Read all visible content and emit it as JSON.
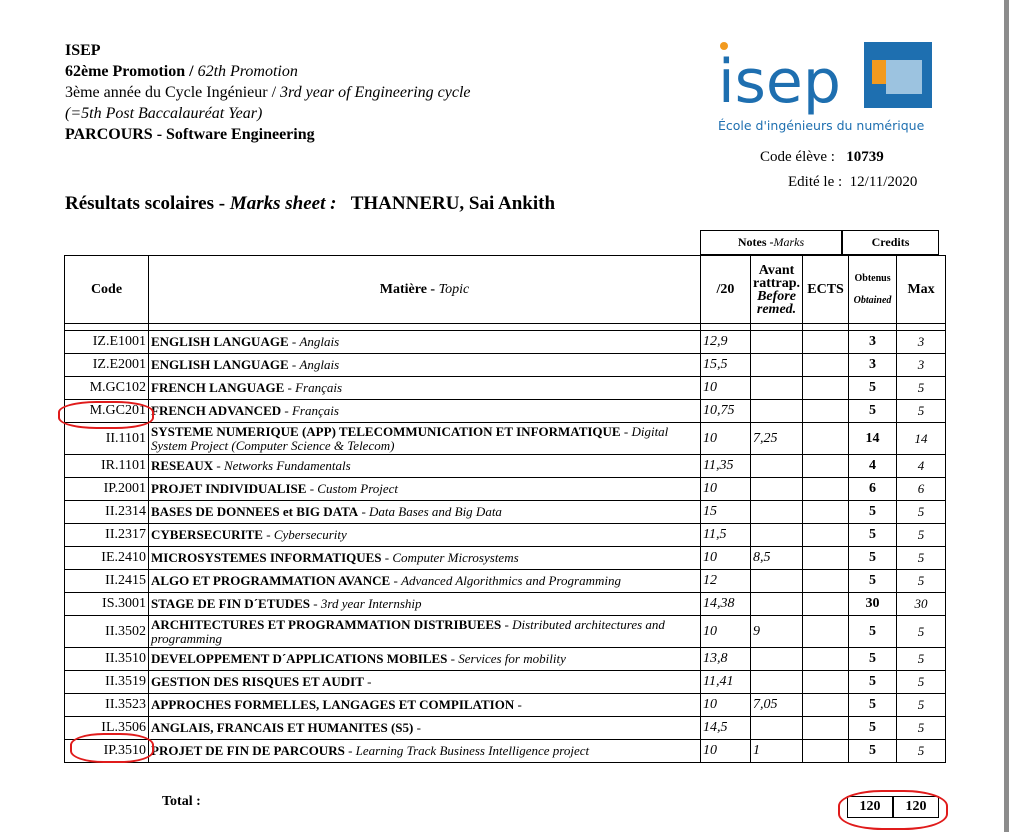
{
  "header": {
    "school": "ISEP",
    "promotion_fr": "62ème Promotion / ",
    "promotion_en": "62th Promotion",
    "year_fr": "3ème année du Cycle Ingénieur / ",
    "year_en": "3rd year of Engineering cycle",
    "post_bac": "(=5th Post Baccalauréat Year)",
    "parcours": "PARCOURS - Software Engineering"
  },
  "logo": {
    "name": "isep",
    "tagline": "École d'ingénieurs du numérique",
    "colors": {
      "blue": "#1e6fb0",
      "orange": "#f29a1f",
      "light_blue": "#9cc3e0"
    }
  },
  "meta": {
    "code_label": "Code élève :",
    "code_value": "10739",
    "date_label": "Edité le :",
    "date_value": "12/11/2020"
  },
  "title": {
    "fr": "Résultats scolaires - ",
    "en": "Marks sheet :",
    "student": "THANNERU, Sai Ankith"
  },
  "table": {
    "group_notes_fr": "Notes - ",
    "group_notes_en": "Marks",
    "group_credits": "Credits",
    "col_code": "Code",
    "col_topic_fr": "Matière - ",
    "col_topic_en": "Topic",
    "col_20": "/20",
    "col_avant_1": "Avant",
    "col_avant_2": "rattrap.",
    "col_before_1": "Before",
    "col_before_2": "remed.",
    "col_ects": "ECTS",
    "col_obtenus": "Obtenus",
    "col_obtained": "Obtained",
    "col_max": "Max",
    "rows": [
      {
        "code": "IZ.E1001",
        "fr": "ENGLISH LANGUAGE",
        "en": "Anglais",
        "mark": "12,9",
        "before": "",
        "obt": "3",
        "max": "3"
      },
      {
        "code": "IZ.E2001",
        "fr": "ENGLISH LANGUAGE",
        "en": "Anglais",
        "mark": "15,5",
        "before": "",
        "obt": "3",
        "max": "3"
      },
      {
        "code": "M.GC102",
        "fr": "FRENCH LANGUAGE",
        "en": "Français",
        "mark": "10",
        "before": "",
        "obt": "5",
        "max": "5"
      },
      {
        "code": "M.GC201",
        "fr": "FRENCH ADVANCED",
        "en": "Français",
        "mark": "10,75",
        "before": "",
        "obt": "5",
        "max": "5"
      },
      {
        "code": "II.1101",
        "fr": "SYSTEME NUMERIQUE (APP) TELECOMMUNICATION ET INFORMATIQUE",
        "en": "Digital System Project (Computer Science & Telecom)",
        "mark": "10",
        "before": "7,25",
        "obt": "14",
        "max": "14"
      },
      {
        "code": "IR.1101",
        "fr": "RESEAUX",
        "en": "Networks Fundamentals",
        "mark": "11,35",
        "before": "",
        "obt": "4",
        "max": "4"
      },
      {
        "code": "IP.2001",
        "fr": "PROJET INDIVIDUALISE",
        "en": "Custom Project",
        "mark": "10",
        "before": "",
        "obt": "6",
        "max": "6"
      },
      {
        "code": "II.2314",
        "fr": "BASES DE DONNEES et BIG DATA",
        "en": "Data Bases and Big Data",
        "mark": "15",
        "before": "",
        "obt": "5",
        "max": "5"
      },
      {
        "code": "II.2317",
        "fr": "CYBERSECURITE",
        "en": "Cybersecurity",
        "mark": "11,5",
        "before": "",
        "obt": "5",
        "max": "5"
      },
      {
        "code": "IE.2410",
        "fr": "MICROSYSTEMES INFORMATIQUES",
        "en": "Computer Microsystems",
        "mark": "10",
        "before": "8,5",
        "obt": "5",
        "max": "5"
      },
      {
        "code": "II.2415",
        "fr": "ALGO ET PROGRAMMATION AVANCE",
        "en": "Advanced Algorithmics and Programming",
        "mark": "12",
        "before": "",
        "obt": "5",
        "max": "5"
      },
      {
        "code": "IS.3001",
        "fr": "STAGE DE FIN D´ETUDES",
        "en": "3rd year Internship",
        "mark": "14,38",
        "before": "",
        "obt": "30",
        "max": "30"
      },
      {
        "code": "II.3502",
        "fr": "ARCHITECTURES ET PROGRAMMATION DISTRIBUEES",
        "en": "Distributed architectures and programming",
        "mark": "10",
        "before": "9",
        "obt": "5",
        "max": "5"
      },
      {
        "code": "II.3510",
        "fr": "DEVELOPPEMENT D´APPLICATIONS MOBILES",
        "en": "Services for mobility",
        "mark": "13,8",
        "before": "",
        "obt": "5",
        "max": "5"
      },
      {
        "code": "II.3519",
        "fr": "GESTION DES RISQUES ET AUDIT",
        "en": "",
        "mark": "11,41",
        "before": "",
        "obt": "5",
        "max": "5"
      },
      {
        "code": "II.3523",
        "fr": "APPROCHES FORMELLES, LANGAGES ET COMPILATION",
        "en": "",
        "mark": "10",
        "before": "7,05",
        "obt": "5",
        "max": "5"
      },
      {
        "code": "IL.3506",
        "fr": "ANGLAIS, FRANCAIS ET HUMANITES (S5)",
        "en": "",
        "mark": "14,5",
        "before": "",
        "obt": "5",
        "max": "5"
      },
      {
        "code": "IP.3510",
        "fr": "PROJET DE FIN DE PARCOURS",
        "en": "Learning Track Business Intelligence project",
        "mark": "10",
        "before": "1",
        "obt": "5",
        "max": "5"
      }
    ]
  },
  "total": {
    "label": "Total :",
    "obtained": "120",
    "max": "120"
  },
  "annotation_color": "#e01b1b"
}
